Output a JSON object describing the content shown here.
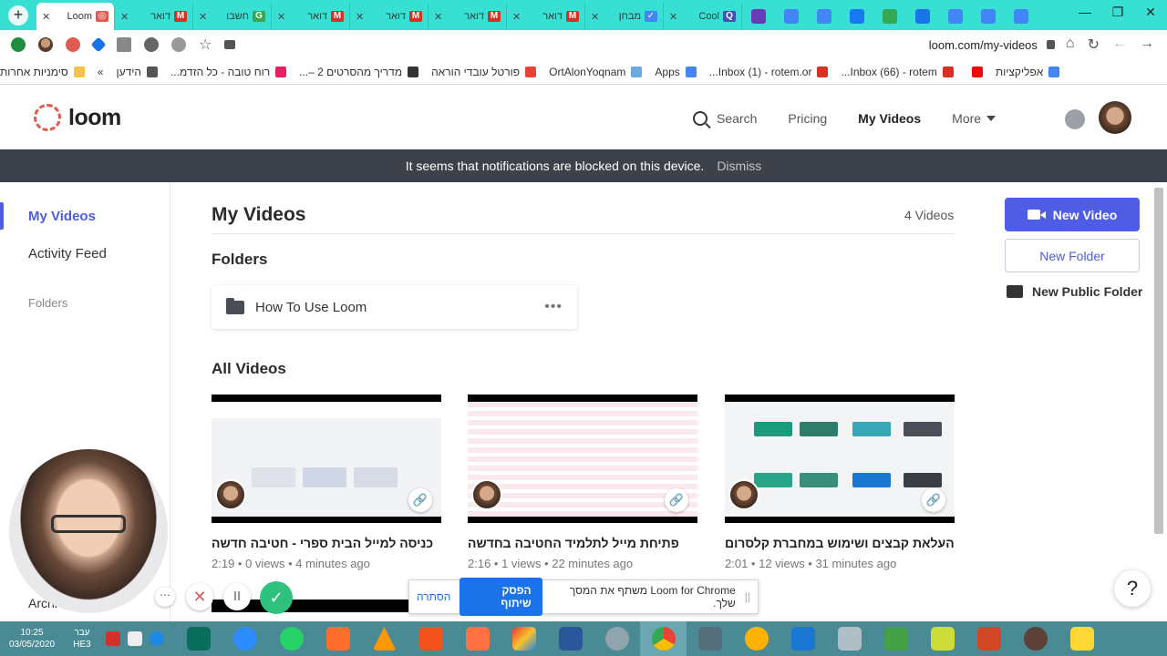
{
  "browser": {
    "tabs": [
      {
        "label": "Loom",
        "fav_color": "#e05a4f",
        "fav_glyph": "◎",
        "active": true
      },
      {
        "label": "דואר",
        "fav_color": "#d93025",
        "fav_glyph": "M"
      },
      {
        "label": "חשבו",
        "fav_color": "#34a853",
        "fav_glyph": "G"
      },
      {
        "label": "דואר",
        "fav_color": "#d93025",
        "fav_glyph": "M"
      },
      {
        "label": "דואר",
        "fav_color": "#d93025",
        "fav_glyph": "M"
      },
      {
        "label": "דואר",
        "fav_color": "#d93025",
        "fav_glyph": "M"
      },
      {
        "label": "דואר",
        "fav_color": "#d93025",
        "fav_glyph": "M"
      },
      {
        "label": "מבחן",
        "fav_color": "#4285f4",
        "fav_glyph": "✓"
      },
      {
        "label": "Cool",
        "fav_color": "#3f51b5",
        "fav_glyph": "Q"
      }
    ],
    "pinned_tab_colors": [
      "#673ab7",
      "#4285f4",
      "#4285f4",
      "#1877f2",
      "#34a853",
      "#1a73e8",
      "#4285f4",
      "#4285f4",
      "#4285f4"
    ],
    "url": "loom.com/my-videos",
    "bookmarks": [
      {
        "label": "אפליקציות",
        "icon_color": "#4285f4"
      },
      {
        "label": "",
        "icon_color": "#ff0000"
      },
      {
        "label": "Inbox (66) - rotem...",
        "icon_color": "#d93025"
      },
      {
        "label": "Inbox (1) - rotem.or...",
        "icon_color": "#d93025"
      },
      {
        "label": "Apps",
        "icon_color": "#4285f4"
      },
      {
        "label": "OrtAlonYoqnam",
        "icon_color": "#6fa8dc"
      },
      {
        "label": "פורטל עובדי הוראה",
        "icon_color": "#ea4335"
      },
      {
        "label": "מדריך מהסרטים 2 –...",
        "icon_color": "#333333"
      },
      {
        "label": "רוח טובה - כל הזדמ...",
        "icon_color": "#e91e63"
      },
      {
        "label": "הידען",
        "icon_color": "#555555"
      },
      {
        "label": "»",
        "icon_color": ""
      },
      {
        "label": "סימניות אחרות",
        "icon_color": "#f6c344"
      }
    ]
  },
  "loom": {
    "brand": "loom",
    "nav": {
      "search": "Search",
      "pricing": "Pricing",
      "my_videos": "My Videos",
      "more": "More"
    },
    "banner": {
      "message": "It seems that notifications are blocked on this device.",
      "dismiss": "Dismiss"
    },
    "sidebar": {
      "my_videos": "My Videos",
      "activity_feed": "Activity Feed",
      "folders": "Folders",
      "archive": "Archi"
    },
    "main": {
      "title": "My Videos",
      "count": "4 Videos",
      "folders_heading": "Folders",
      "folder_name": "How To Use Loom",
      "all_videos_heading": "All Videos",
      "videos": [
        {
          "title": "כניסה למייל הבית ספרי - חטיבה חדשה",
          "duration": "2:19",
          "views": "0 views",
          "age": "4 minutes ago"
        },
        {
          "title": "פתיחת מייל לתלמיד החטיבה בחדשה",
          "duration": "2:16",
          "views": "1 views",
          "age": "22 minutes ago"
        },
        {
          "title": "העלאת קבצים ושימוש במחברת קלסרום",
          "duration": "2:01",
          "views": "12 views",
          "age": "31 minutes ago"
        }
      ]
    },
    "actions": {
      "new_video": "New Video",
      "new_folder": "New Folder",
      "new_public_folder": "New Public Folder"
    },
    "help": "?"
  },
  "sharebar": {
    "message": "Loom for Chrome משתף את המסך שלך.",
    "stop": "הפסק שיתוף",
    "hide": "הסתרה"
  },
  "taskbar": {
    "time": "10:25",
    "date": "03/05/2020",
    "lang_top": "עבר",
    "lang_bottom": "HE3"
  }
}
